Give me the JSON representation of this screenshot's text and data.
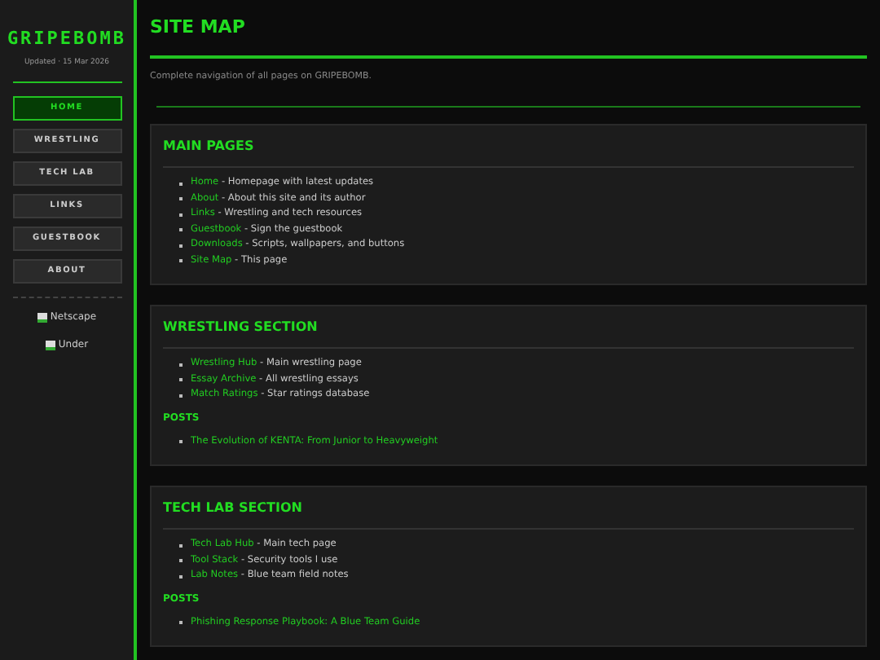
{
  "site": {
    "title": "GRIPEBOMB",
    "subtitle": "Updated · 15 Mar 2026"
  },
  "nav": [
    {
      "label": "HOME",
      "selected": true
    },
    {
      "label": "WRESTLING",
      "selected": false
    },
    {
      "label": "TECH LAB",
      "selected": false
    },
    {
      "label": "LINKS",
      "selected": false
    },
    {
      "label": "GUESTBOOK",
      "selected": false
    },
    {
      "label": "ABOUT",
      "selected": false
    }
  ],
  "badges": [
    "Netscape",
    "Under"
  ],
  "page": {
    "title": "SITE MAP",
    "intro": "Complete navigation of all pages on GRIPEBOMB."
  },
  "sections": [
    {
      "title": "MAIN PAGES",
      "links": [
        {
          "label": "Home",
          "desc": " - Homepage with latest updates"
        },
        {
          "label": "About",
          "desc": " - About this site and its author"
        },
        {
          "label": "Links",
          "desc": " - Wrestling and tech resources"
        },
        {
          "label": "Guestbook",
          "desc": " - Sign the guestbook"
        },
        {
          "label": "Downloads",
          "desc": " - Scripts, wallpapers, and buttons"
        },
        {
          "label": "Site Map",
          "desc": " - This page"
        }
      ]
    },
    {
      "title": "WRESTLING SECTION",
      "links": [
        {
          "label": "Wrestling Hub",
          "desc": " - Main wrestling page"
        },
        {
          "label": "Essay Archive",
          "desc": " - All wrestling essays"
        },
        {
          "label": "Match Ratings",
          "desc": " - Star ratings database"
        }
      ],
      "posts_heading": "POSTS",
      "posts": [
        "The Evolution of KENTA: From Junior to Heavyweight"
      ]
    },
    {
      "title": "TECH LAB SECTION",
      "links": [
        {
          "label": "Tech Lab Hub",
          "desc": " - Main tech page"
        },
        {
          "label": "Tool Stack",
          "desc": " - Security tools I use"
        },
        {
          "label": "Lab Notes",
          "desc": " - Blue team field notes"
        }
      ],
      "posts_heading": "POSTS",
      "posts": [
        "Phishing Response Playbook: A Blue Team Guide"
      ]
    }
  ]
}
